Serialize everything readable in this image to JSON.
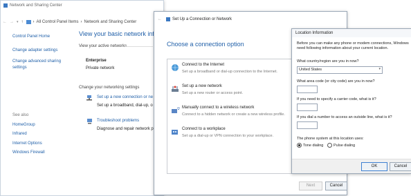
{
  "nsc": {
    "title": "Network and Sharing Center",
    "address": [
      "All Control Panel Items",
      "Network and Sharing Center"
    ],
    "home_link": "Control Panel Home",
    "left_links": [
      "Change adapter settings",
      "Change advanced sharing settings"
    ],
    "heading": "View your basic network infor",
    "active_networks_label": "View your active networks",
    "network_name": "Enterprise",
    "network_type": "Private network",
    "change_settings_label": "Change your networking settings",
    "setup_link": "Set up a new connection or ne",
    "setup_desc": "Set up a broadband, dial-up, o",
    "troubleshoot_link": "Troubleshoot problems",
    "troubleshoot_desc": "Diagnose and repair network p",
    "see_also": "See also",
    "see_also_links": [
      "HomeGroup",
      "Infrared",
      "Internet Options",
      "Windows Firewall"
    ]
  },
  "wizard": {
    "title": "Set Up a Connection or Network",
    "heading": "Choose a connection option",
    "options": [
      {
        "label": "Connect to the Internet",
        "desc": "Set up a broadband or dial-up connection to the Internet.",
        "icon": "globe-icon"
      },
      {
        "label": "Set up a new network",
        "desc": "Set up a new router or access point.",
        "icon": "router-icon"
      },
      {
        "label": "Manually connect to a wireless network",
        "desc": "Connect to a hidden network or create a new wireless profile.",
        "icon": "wireless-icon"
      },
      {
        "label": "Connect to a workplace",
        "desc": "Set up a dial-up or VPN connection to your workplace.",
        "icon": "workplace-icon"
      }
    ],
    "next": "Next",
    "cancel": "Cancel"
  },
  "location": {
    "title": "Location Information",
    "intro": "Before you can make any phone or modem connections, Windows need following information about your current location.",
    "country_label": "What country/region are you in now?",
    "country_value": "United States",
    "area_label": "What area code (or city code) are you in now?",
    "carrier_label": "If you need to specify a carrier code, what is it?",
    "outside_label": "If you dial a number to access an outside line, what is it?",
    "phone_system_label": "The phone system at this location uses:",
    "tone": "Tone dialing",
    "pulse": "Pulse dialing",
    "ok": "OK",
    "cancel": "Cancel"
  }
}
